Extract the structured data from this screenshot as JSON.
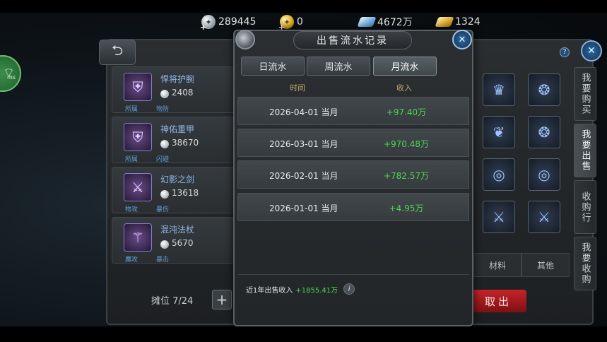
{
  "currency": [
    {
      "icon": "silver-coin-icon",
      "value": "289445"
    },
    {
      "icon": "gold-coin-icon",
      "value": "0"
    },
    {
      "icon": "diamond-icon",
      "value": "4672万"
    },
    {
      "icon": "gold-bar-icon",
      "value": "1324"
    }
  ],
  "background": {
    "wifi_label": "ms",
    "items": [
      {
        "name": "悍将护腕",
        "price": "2408",
        "tag1": "所属",
        "tag2": "物防"
      },
      {
        "name": "神佑重甲",
        "price": "38670",
        "tag1": "所属",
        "tag2": "闪避"
      },
      {
        "name": "幻影之剑",
        "price": "13618",
        "tag1": "物攻",
        "tag2": "暴伤"
      },
      {
        "name": "混沌法杖",
        "price": "5670",
        "tag1": "魔攻",
        "tag2": "暴击"
      }
    ],
    "slots": "摊位 7/24",
    "filters": [
      "材料",
      "其他"
    ],
    "sell_button": "取出",
    "side_tabs": [
      "我要购买",
      "我要出售",
      "收购行",
      "我要收购"
    ]
  },
  "modal": {
    "title": "出售流水记录",
    "tabs": [
      "日流水",
      "周流水",
      "月流水"
    ],
    "active_tab": "月流水",
    "columns": {
      "time": "时间",
      "income": "收入"
    },
    "rows": [
      {
        "date": "2026-04-01 当月",
        "income": "+97.40万"
      },
      {
        "date": "2026-03-01 当月",
        "income": "+970.48万"
      },
      {
        "date": "2026-02-01 当月",
        "income": "+782.57万"
      },
      {
        "date": "2026-01-01 当月",
        "income": "+4.95万"
      }
    ],
    "total_label": "近1年出售收入",
    "total_value": "+1855.41万",
    "income_color": "#4cd94c"
  }
}
